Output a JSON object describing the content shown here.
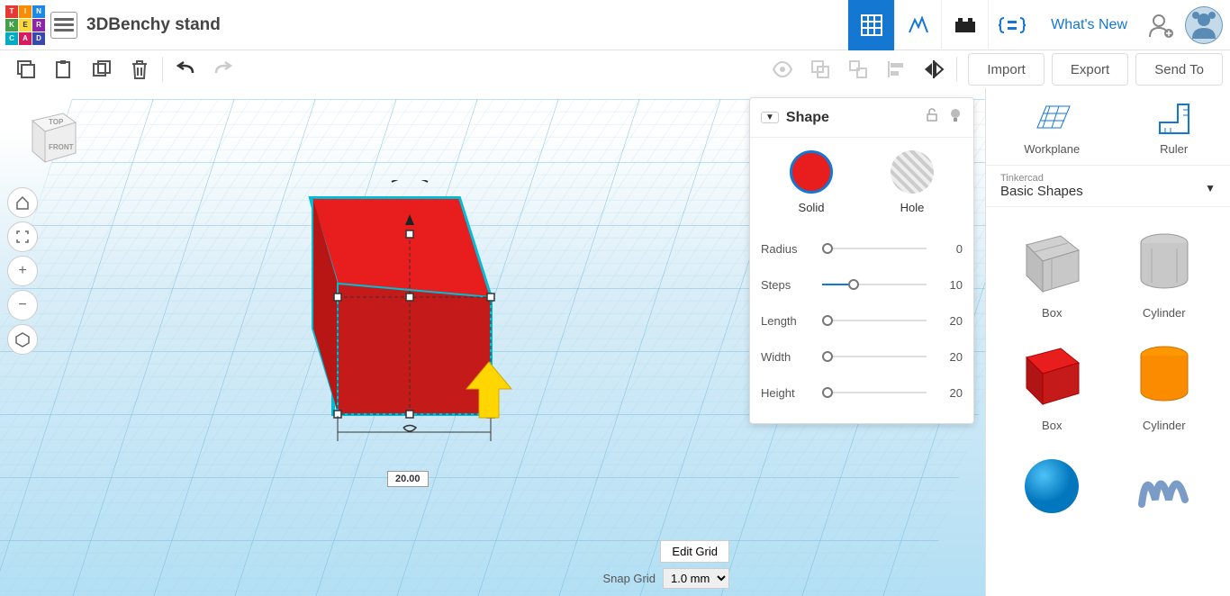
{
  "header": {
    "title": "3DBenchy stand",
    "whats_new": "What's New"
  },
  "toolbar": {
    "import": "Import",
    "export": "Export",
    "send_to": "Send To"
  },
  "inspector": {
    "title": "Shape",
    "solid": "Solid",
    "hole": "Hole",
    "props": [
      {
        "label": "Radius",
        "value": "0",
        "pos": 0
      },
      {
        "label": "Steps",
        "value": "10",
        "pos": 25
      },
      {
        "label": "Length",
        "value": "20",
        "pos": 0
      },
      {
        "label": "Width",
        "value": "20",
        "pos": 0
      },
      {
        "label": "Height",
        "value": "20",
        "pos": 0
      }
    ]
  },
  "sidebar": {
    "workplane": "Workplane",
    "ruler": "Ruler",
    "cat_small": "Tinkercad",
    "cat_large": "Basic Shapes",
    "shapes": [
      "Box",
      "Cylinder",
      "Box",
      "Cylinder"
    ]
  },
  "canvas": {
    "dim": "20.00",
    "cube_top": "TOP",
    "cube_front": "FRONT"
  },
  "grid_controls": {
    "edit": "Edit Grid",
    "snap_label": "Snap Grid",
    "snap_value": "1.0 mm"
  }
}
